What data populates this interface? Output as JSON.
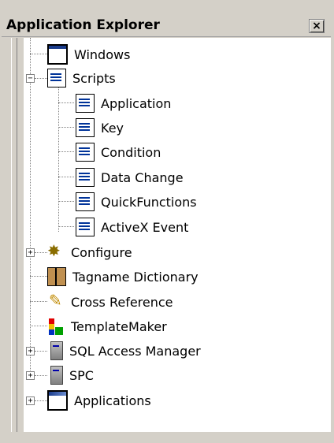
{
  "panel": {
    "title": "Application Explorer",
    "close_label": "×"
  },
  "tree": {
    "windows": "Windows",
    "scripts": "Scripts",
    "scripts_children": [
      "Application",
      "Key",
      "Condition",
      "Data Change",
      "QuickFunctions",
      "ActiveX Event"
    ],
    "configure": "Configure",
    "tagname_dictionary": "Tagname Dictionary",
    "cross_reference": "Cross Reference",
    "template_maker": "TemplateMaker",
    "sql_access_manager": "SQL Access Manager",
    "spc": "SPC",
    "applications": "Applications"
  }
}
